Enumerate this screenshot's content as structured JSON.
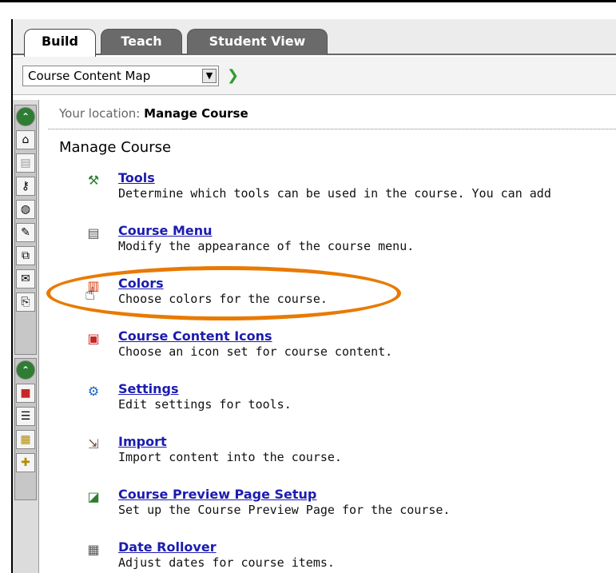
{
  "tabs": [
    {
      "label": "Build",
      "active": true
    },
    {
      "label": "Teach",
      "active": false
    },
    {
      "label": "Student View",
      "active": false
    }
  ],
  "select": {
    "value": "Course Content Map"
  },
  "location": {
    "prefix": "Your location:",
    "current": "Manage Course"
  },
  "page_title": "Manage Course",
  "items": [
    {
      "title": "Tools",
      "description": "Determine which tools can be used in the course. You can add",
      "icon": "tools-icon"
    },
    {
      "title": "Course Menu",
      "description": "Modify the appearance of the course menu.",
      "icon": "course-menu-icon"
    },
    {
      "title": "Colors",
      "description": "Choose colors for the course.",
      "icon": "colors-icon"
    },
    {
      "title": "Course Content Icons",
      "description": "Choose an icon set for course content.",
      "icon": "course-content-icons-icon"
    },
    {
      "title": "Settings",
      "description": "Edit settings for tools.",
      "icon": "settings-icon"
    },
    {
      "title": "Import",
      "description": "Import content into the course.",
      "icon": "import-icon"
    },
    {
      "title": "Course Preview Page Setup",
      "description": "Set up the Course Preview Page for the course.",
      "icon": "course-preview-icon"
    },
    {
      "title": "Date Rollover",
      "description": "Adjust dates for course items.",
      "icon": "date-rollover-icon"
    }
  ],
  "colors": {
    "link": "#1c1cb0",
    "highlight": "#e87a00",
    "tab_inactive": "#6a6a6a"
  }
}
